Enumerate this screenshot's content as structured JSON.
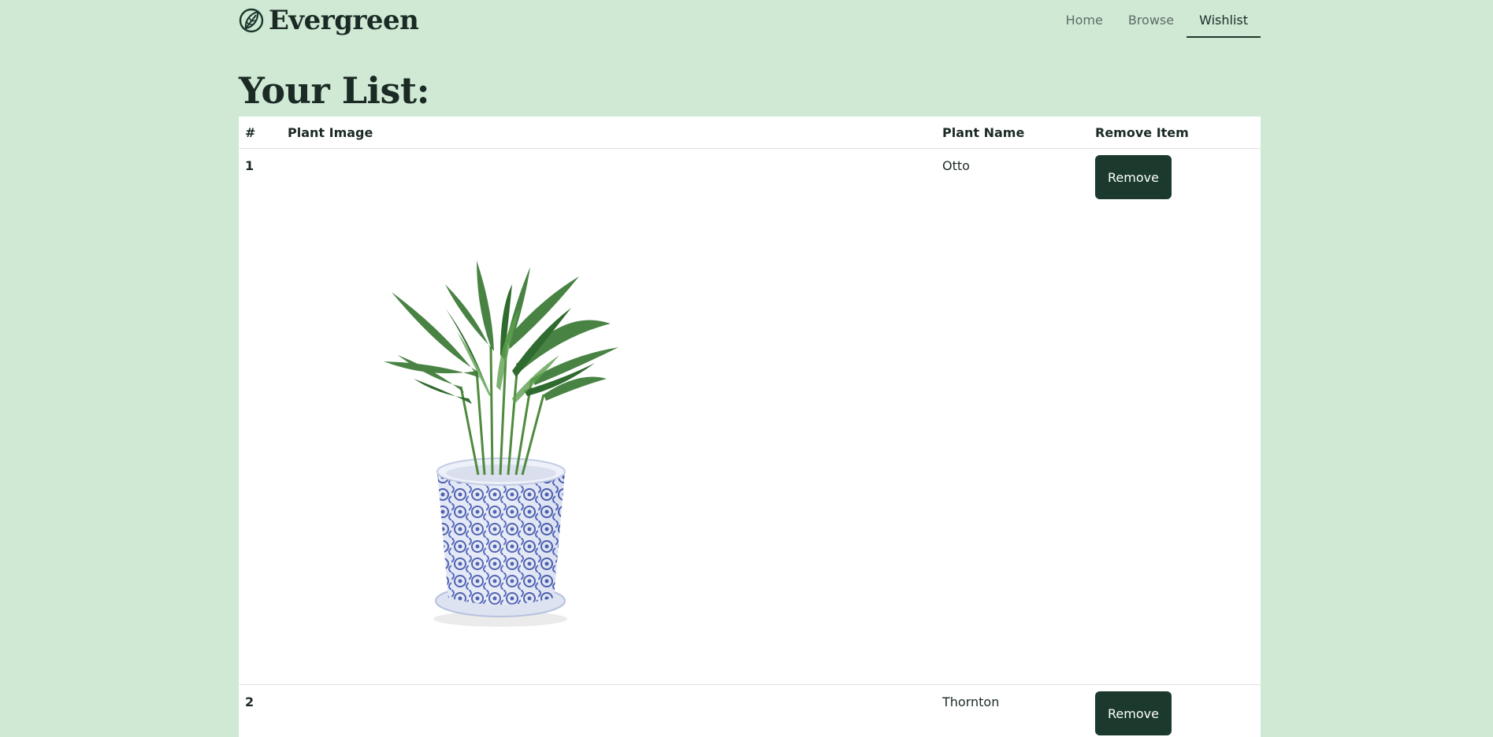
{
  "header": {
    "brand": "Evergreen",
    "nav": {
      "home": "Home",
      "browse": "Browse",
      "wishlist": "Wishlist"
    },
    "active_nav": "Wishlist"
  },
  "page": {
    "title": "Your List:"
  },
  "table": {
    "headers": {
      "num": "#",
      "image": "Plant Image",
      "name": "Plant Name",
      "remove": "Remove Item"
    },
    "rows": [
      {
        "num": "1",
        "name": "Otto",
        "button": "Remove",
        "image": "potted-palm-blue-white-pot"
      },
      {
        "num": "2",
        "name": "Thornton",
        "button": "Remove",
        "image": ""
      }
    ]
  },
  "colors": {
    "background": "#cfe9d5",
    "accent": "#1b3a2d",
    "text": "#1b2a24"
  }
}
